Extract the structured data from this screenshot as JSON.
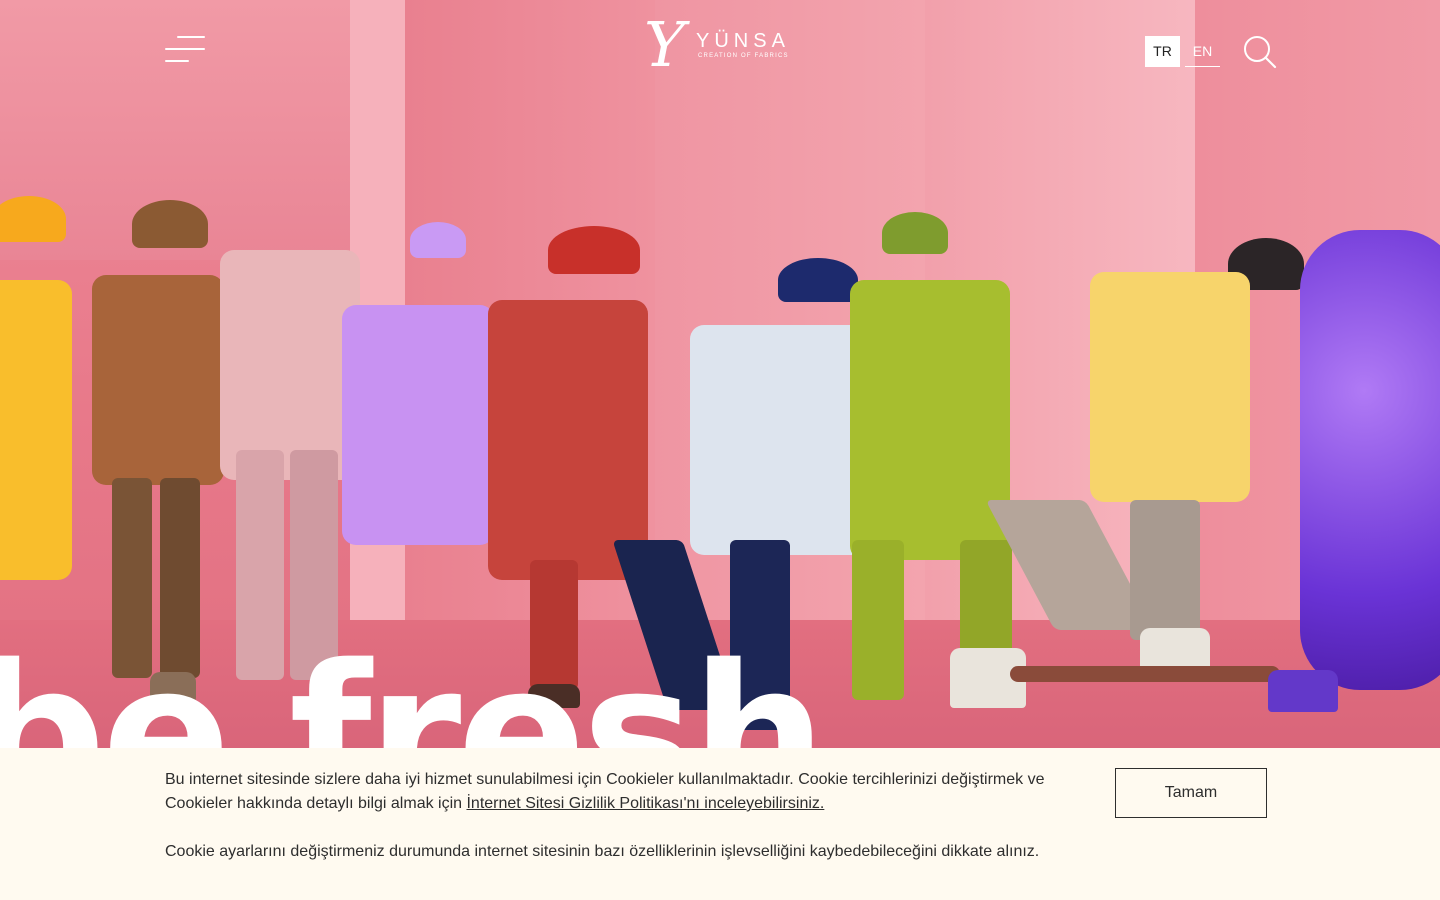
{
  "header": {
    "menu_icon": "hamburger-menu-icon",
    "logo": {
      "mark": "Y",
      "name": "YÜNSA",
      "tagline": "CREATION OF FABRICS"
    },
    "languages": [
      {
        "code": "TR",
        "active": true
      },
      {
        "code": "EN",
        "active": false
      }
    ],
    "search_icon": "search-icon"
  },
  "hero": {
    "headline": "be fresh",
    "colors": {
      "background": "#e9798a",
      "headline": "#ffffff"
    }
  },
  "cookie_banner": {
    "text_before_link": "Bu internet sitesinde sizlere daha iyi hizmet sunulabilmesi için Cookieler kullanılmaktadır. Cookie tercihlerinizi değiştirmek ve Cookieler hakkında detaylı bilgi almak için ",
    "link_text": "İnternet Sitesi Gizlilik Politikası'nı inceleyebilirsiniz.",
    "note": "Cookie ayarlarını değiştirmeniz durumunda internet sitesinin bazı özelliklerinin işlevselliğini kaybedebileceğini dikkate alınız.",
    "accept_label": "Tamam",
    "background": "#fffaf0"
  }
}
